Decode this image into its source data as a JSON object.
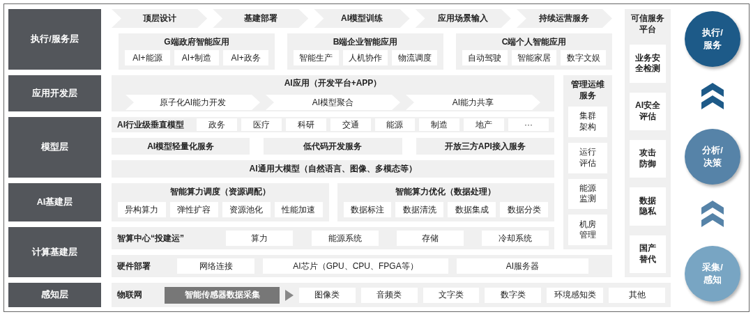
{
  "layer_labels": [
    "执行/服务层",
    "应用开发层",
    "模型层",
    "AI基建层",
    "计算基建层",
    "感知层"
  ],
  "process_steps": [
    "顶层设计",
    "基建部署",
    "AI模型训练",
    "应用场景输入",
    "持续运营服务"
  ],
  "application_groups": [
    {
      "title": "G端政府智能应用",
      "items": [
        "AI+能源",
        "AI+制造",
        "AI+政务"
      ]
    },
    {
      "title": "B端企业智能应用",
      "items": [
        "智能生产",
        "人机协作",
        "物流调度"
      ]
    },
    {
      "title": "C端个人智能应用",
      "items": [
        "自动驾驶",
        "智能家居",
        "数字文娱"
      ]
    }
  ],
  "app_development": {
    "title": "AI应用（开发平台+APP）",
    "steps": [
      "原子化AI能力开发",
      "AI模型聚合",
      "AI能力共享"
    ]
  },
  "vertical_models": {
    "title": "AI行业级垂直模型",
    "items": [
      "政务",
      "医疗",
      "科研",
      "交通",
      "能源",
      "制造",
      "地产",
      "···"
    ]
  },
  "model_services": [
    "AI模型轻量化服务",
    "低代码开发服务",
    "开放三方API接入服务"
  ],
  "general_model": "AI通用大模型（自然语言、图像、多模态等）",
  "compute_groups": [
    {
      "title": "智能算力调度（资源调配）",
      "items": [
        "异构算力",
        "弹性扩容",
        "资源池化",
        "性能加速"
      ]
    },
    {
      "title": "智能算力优化（数据处理）",
      "items": [
        "数据标注",
        "数据清洗",
        "数据集成",
        "数据分类"
      ]
    }
  ],
  "center_construction": {
    "title": "智算中心“投建运”",
    "items": [
      "算力",
      "能源系统",
      "存储",
      "冷却系统"
    ]
  },
  "hardware": {
    "title": "硬件部署",
    "items": [
      "网络连接",
      "AI芯片（GPU、CPU、FPGA等）",
      "AI服务器"
    ]
  },
  "iot": {
    "title": "物联网",
    "items": [
      {
        "text": "智能传感器数据采集",
        "kind": "highlight"
      },
      {
        "text": "图像类",
        "kind": "normal"
      },
      {
        "text": "音频类",
        "kind": "normal"
      },
      {
        "text": "文字类",
        "kind": "normal"
      },
      {
        "text": "数字类",
        "kind": "normal"
      },
      {
        "text": "环境感知类",
        "kind": "normal"
      },
      {
        "text": "其他",
        "kind": "normal"
      }
    ]
  },
  "operations": {
    "title": "管理运维服务",
    "items": [
      "集群架构",
      "运行评估",
      "能源监测",
      "机房管理"
    ]
  },
  "trusted_platform": {
    "title": "可信服务平台",
    "items": [
      "业务安全检测",
      "AI安全评估",
      "攻击防御",
      "数据隐私",
      "国产替代"
    ]
  },
  "stages": [
    {
      "label": "执行/服务",
      "color": "#1d5a88"
    },
    {
      "label": "分析/决策",
      "color": "#5683a8"
    },
    {
      "label": "采集/感知",
      "color": "#78a5c3"
    }
  ]
}
